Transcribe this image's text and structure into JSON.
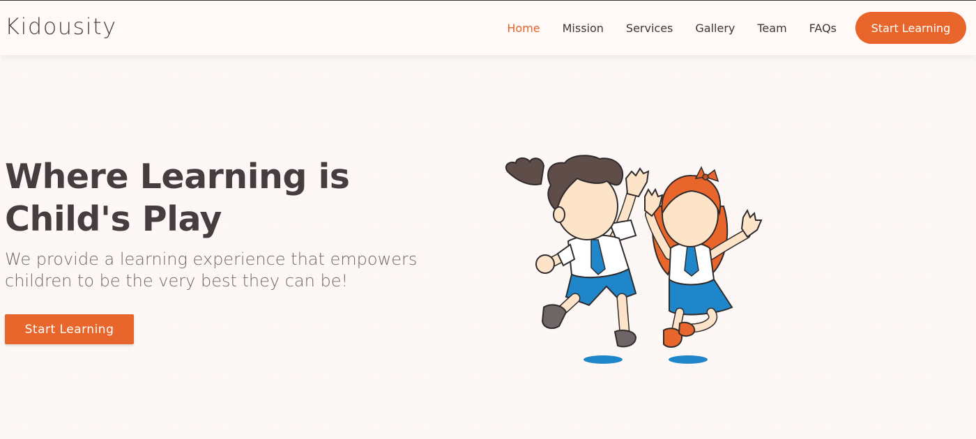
{
  "brand": {
    "name": "Kidousity"
  },
  "nav": {
    "items": [
      {
        "label": "Home",
        "active": true
      },
      {
        "label": "Mission",
        "active": false
      },
      {
        "label": "Services",
        "active": false
      },
      {
        "label": "Gallery",
        "active": false
      },
      {
        "label": "Team",
        "active": false
      },
      {
        "label": "FAQs",
        "active": false
      }
    ],
    "cta_label": "Start Learning"
  },
  "hero": {
    "title": "Where Learning is Child's Play",
    "subtitle": "We provide a learning experience that empowers children to be the very best they can be!",
    "cta_label": "Start Learning"
  },
  "colors": {
    "accent": "#e8652b",
    "text_dark": "#463d40",
    "text_muted": "#6f6668",
    "background": "#fdf8f6"
  },
  "illustration": {
    "icon": "kids-jumping-illustration"
  }
}
